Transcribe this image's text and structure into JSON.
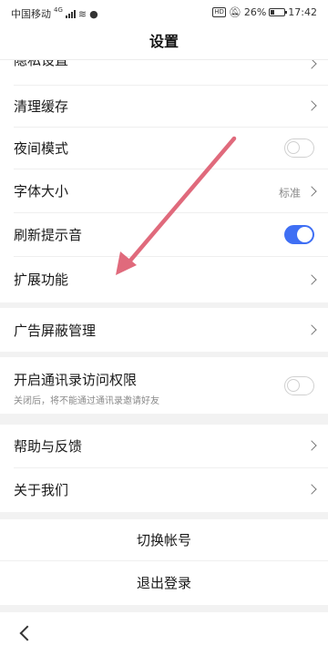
{
  "status_bar": {
    "carrier": "中国移动",
    "carrier_network": "4G",
    "hd_badge": "HD",
    "battery": "26%",
    "time": "17:42",
    "icons": [
      "signal-icon",
      "wifi-icon",
      "wechat-icon",
      "mute-icon",
      "battery-icon"
    ]
  },
  "header": {
    "title": "设置"
  },
  "settings": {
    "privacy": {
      "label": "隐私设置"
    },
    "clear_cache": {
      "label": "清理缓存"
    },
    "night_mode": {
      "label": "夜间模式",
      "enabled": false
    },
    "font_size": {
      "label": "字体大小",
      "value": "标准"
    },
    "refresh_sound": {
      "label": "刷新提示音",
      "enabled": true
    },
    "extensions": {
      "label": "扩展功能"
    },
    "ad_block": {
      "label": "广告屏蔽管理"
    },
    "contacts_permission": {
      "label": "开启通讯录访问权限",
      "sublabel": "关闭后，将不能通过通讯录邀请好友",
      "enabled": false
    },
    "help": {
      "label": "帮助与反馈"
    },
    "about": {
      "label": "关于我们"
    }
  },
  "account": {
    "switch_label": "切换帐号",
    "logout_label": "退出登录"
  },
  "colors": {
    "accent": "#3f6ff4",
    "annotation_arrow": "#e06a7c"
  }
}
